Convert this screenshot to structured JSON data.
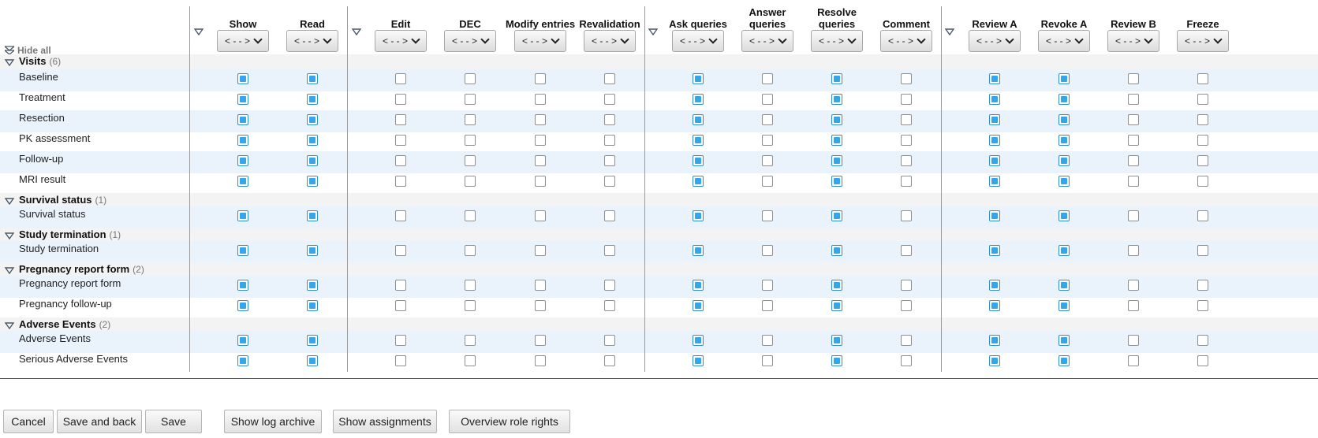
{
  "header": {
    "hide_all_label": "Hide all",
    "columns": [
      {
        "label": "Show",
        "filter": "< - - >"
      },
      {
        "label": "Read",
        "filter": "< - - >"
      },
      {
        "label": "Edit",
        "filter": "< - - >"
      },
      {
        "label": "DEC",
        "filter": "< - - >"
      },
      {
        "label": "Modify entries",
        "filter": "< - - >"
      },
      {
        "label": "Revalidation",
        "filter": "< - - >"
      },
      {
        "label": "Ask queries",
        "filter": "< - - >"
      },
      {
        "label": "Answer queries",
        "filter": "< - - >"
      },
      {
        "label": "Resolve queries",
        "filter": "< - - >"
      },
      {
        "label": "Comment",
        "filter": "< - - >"
      },
      {
        "label": "Review A",
        "filter": "< - - >"
      },
      {
        "label": "Revoke A",
        "filter": "< - - >"
      },
      {
        "label": "Review B",
        "filter": "< - - >"
      },
      {
        "label": "Freeze",
        "filter": "< - - >"
      }
    ]
  },
  "groups": [
    {
      "name": "Visits",
      "count": "(6)",
      "rows": [
        {
          "label": "Baseline",
          "checks": [
            true,
            true,
            false,
            false,
            false,
            false,
            true,
            false,
            true,
            false,
            true,
            true,
            false,
            false
          ]
        },
        {
          "label": "Treatment",
          "checks": [
            true,
            true,
            false,
            false,
            false,
            false,
            true,
            false,
            true,
            false,
            true,
            true,
            false,
            false
          ]
        },
        {
          "label": "Resection",
          "checks": [
            true,
            true,
            false,
            false,
            false,
            false,
            true,
            false,
            true,
            false,
            true,
            true,
            false,
            false
          ]
        },
        {
          "label": "PK assessment",
          "checks": [
            true,
            true,
            false,
            false,
            false,
            false,
            true,
            false,
            true,
            false,
            true,
            true,
            false,
            false
          ]
        },
        {
          "label": "Follow-up",
          "checks": [
            true,
            true,
            false,
            false,
            false,
            false,
            true,
            false,
            true,
            false,
            true,
            true,
            false,
            false
          ]
        },
        {
          "label": "MRI result",
          "checks": [
            true,
            true,
            false,
            false,
            false,
            false,
            true,
            false,
            true,
            false,
            true,
            true,
            false,
            false
          ]
        }
      ]
    },
    {
      "name": "Survival status",
      "count": "(1)",
      "rows": [
        {
          "label": "Survival status",
          "checks": [
            true,
            true,
            false,
            false,
            false,
            false,
            true,
            false,
            true,
            false,
            true,
            true,
            false,
            false
          ]
        }
      ]
    },
    {
      "name": "Study termination",
      "count": "(1)",
      "rows": [
        {
          "label": "Study termination",
          "checks": [
            true,
            true,
            false,
            false,
            false,
            false,
            true,
            false,
            true,
            false,
            true,
            true,
            false,
            false
          ]
        }
      ]
    },
    {
      "name": "Pregnancy report form",
      "count": "(2)",
      "rows": [
        {
          "label": "Pregnancy report form",
          "checks": [
            true,
            true,
            false,
            false,
            false,
            false,
            true,
            false,
            true,
            false,
            true,
            true,
            false,
            false
          ]
        },
        {
          "label": "Pregnancy follow-up",
          "checks": [
            true,
            true,
            false,
            false,
            false,
            false,
            true,
            false,
            true,
            false,
            true,
            true,
            false,
            false
          ]
        }
      ]
    },
    {
      "name": "Adverse Events",
      "count": "(2)",
      "rows": [
        {
          "label": "Adverse Events",
          "checks": [
            true,
            true,
            false,
            false,
            false,
            false,
            true,
            false,
            true,
            false,
            true,
            true,
            false,
            false
          ]
        },
        {
          "label": "Serious Adverse Events",
          "checks": [
            true,
            true,
            false,
            false,
            false,
            false,
            true,
            false,
            true,
            false,
            true,
            true,
            false,
            false
          ]
        }
      ]
    }
  ],
  "footer": {
    "buttons": [
      "Cancel",
      "Save and back",
      "Save",
      "Show log archive",
      "Show assignments",
      "Overview role rights"
    ]
  },
  "colors": {
    "accent": "#35a6ea",
    "row_alt": "#eaf3fb",
    "group_bg": "#f3f3f3"
  }
}
